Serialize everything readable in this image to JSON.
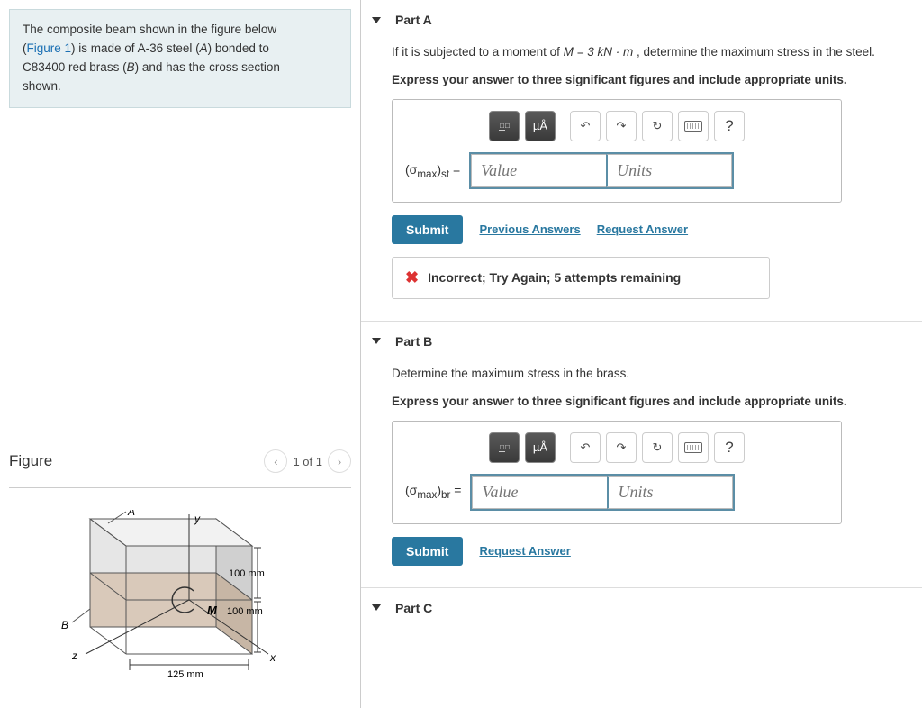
{
  "problem": {
    "line1": "The composite beam shown in the figure below",
    "fig_ref": "Figure 1",
    "line2a": "(",
    "line2b": ") is made of A-36 steel (",
    "varA": "A",
    "line2c": ") bonded to",
    "line3a": "C83400 red brass (",
    "varB": "B",
    "line3b": ") and has the cross section",
    "line4": "shown."
  },
  "figure": {
    "title": "Figure",
    "nav_text": "1 of 1",
    "labels": {
      "A": "A",
      "B": "B",
      "M": "M",
      "x": "x",
      "y": "y",
      "z": "z",
      "d1": "100 mm",
      "d2": "100 mm",
      "d3": "125 mm"
    }
  },
  "partA": {
    "header": "Part A",
    "q1": "If it is subjected to a moment of ",
    "moment_expr": "M = 3 kN · m",
    "q2": " , determine the maximum stress in the steel.",
    "instr": "Express your answer to three significant figures and include appropriate units.",
    "sigma_html": "(σ",
    "sigma_sub": "max",
    "sigma_close": ")",
    "mat_sub": "st",
    "eq": " = ",
    "value_ph": "Value",
    "units_ph": "Units",
    "tool_mu": "µÅ",
    "submit": "Submit",
    "prev": "Previous Answers",
    "req": "Request Answer",
    "feedback": "Incorrect; Try Again; 5 attempts remaining"
  },
  "partB": {
    "header": "Part B",
    "q": "Determine the maximum stress in the brass.",
    "instr": "Express your answer to three significant figures and include appropriate units.",
    "mat_sub": "br",
    "submit": "Submit",
    "req": "Request Answer"
  },
  "partC": {
    "header": "Part C"
  }
}
